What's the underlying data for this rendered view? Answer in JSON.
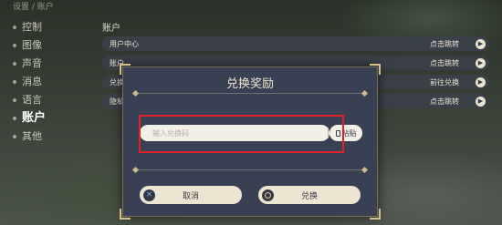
{
  "background": {
    "breadcrumb": "设置 / 账户",
    "sidebar": [
      "控制",
      "图像",
      "声音",
      "消息",
      "语言",
      "账户",
      "其他"
    ],
    "active_sidebar": "账户",
    "section_title": "账户",
    "rows": [
      {
        "label": "用户中心",
        "action": "点击跳转"
      },
      {
        "label": "账户",
        "action": "点击跳转"
      },
      {
        "label": "兑换",
        "action": "前往兑换"
      },
      {
        "label": "隐私",
        "action": "点击跳转"
      }
    ]
  },
  "dialog": {
    "title": "兑换奖励",
    "input_placeholder": "输入兑换码",
    "input_value": "",
    "paste_label": "粘贴",
    "cancel_label": "取消",
    "confirm_label": "兑换"
  },
  "colors": {
    "dialog_bg": "#3a4053",
    "button_bg": "#ece5d2",
    "highlight": "#e0202a",
    "gold_accent": "#d8c08a"
  },
  "icons": {
    "cancel": "x-icon",
    "confirm": "circle-icon",
    "paste": "clipboard-icon"
  }
}
